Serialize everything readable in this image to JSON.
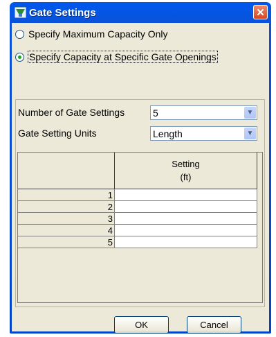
{
  "window": {
    "title": "Gate Settings"
  },
  "options": {
    "max_capacity_label": "Specify Maximum Capacity Only",
    "specific_openings_label": "Specify Capacity at Specific Gate Openings",
    "selected": "specific_openings"
  },
  "fields": {
    "num_settings_label": "Number of Gate Settings",
    "num_settings_value": "5",
    "units_label": "Gate Setting Units",
    "units_value": "Length"
  },
  "table": {
    "header_line1": "Setting",
    "header_line2": "(ft)",
    "rows": [
      {
        "num": "1",
        "value": ""
      },
      {
        "num": "2",
        "value": ""
      },
      {
        "num": "3",
        "value": ""
      },
      {
        "num": "4",
        "value": ""
      },
      {
        "num": "5",
        "value": ""
      }
    ]
  },
  "buttons": {
    "ok": "OK",
    "cancel": "Cancel"
  },
  "icons": {
    "app": "app-icon",
    "close": "close-icon",
    "dropdown": "chevron-down-icon"
  },
  "colors": {
    "titlebar": "#0058ee",
    "client": "#ece9d8",
    "radio_dot": "#21a121"
  }
}
